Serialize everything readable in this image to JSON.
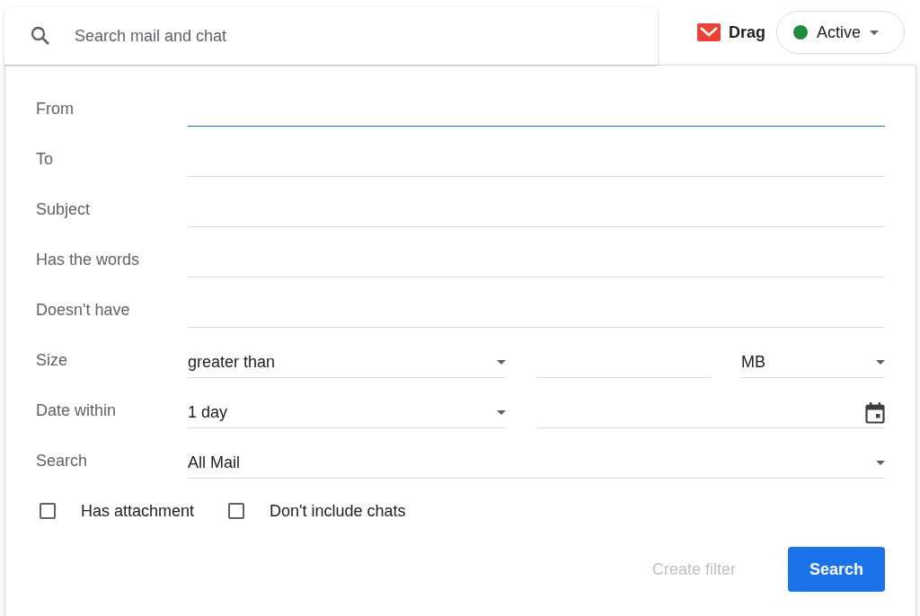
{
  "search": {
    "placeholder": "Search mail and chat"
  },
  "drag": {
    "label": "Drag"
  },
  "status": {
    "label": "Active",
    "color": "#1e8e3e"
  },
  "fields": [
    {
      "kind": "text",
      "label": "From",
      "focused": true
    },
    {
      "kind": "text",
      "label": "To",
      "focused": false
    },
    {
      "kind": "text",
      "label": "Subject",
      "focused": false
    },
    {
      "kind": "text",
      "label": "Has the words",
      "focused": false
    },
    {
      "kind": "text",
      "label": "Doesn't have",
      "focused": false
    },
    {
      "kind": "size",
      "label": "Size",
      "operator": "greater than",
      "unit": "MB"
    },
    {
      "kind": "date",
      "label": "Date within",
      "range": "1 day"
    },
    {
      "kind": "select",
      "label": "Search",
      "value": "All Mail"
    }
  ],
  "checkboxes": [
    {
      "label": "Has attachment",
      "checked": false
    },
    {
      "label": "Don't include chats",
      "checked": false
    }
  ],
  "buttons": [
    {
      "label": "Create filter",
      "kind": "text",
      "disabled": true
    },
    {
      "label": "Search",
      "kind": "primary",
      "disabled": false
    }
  ]
}
